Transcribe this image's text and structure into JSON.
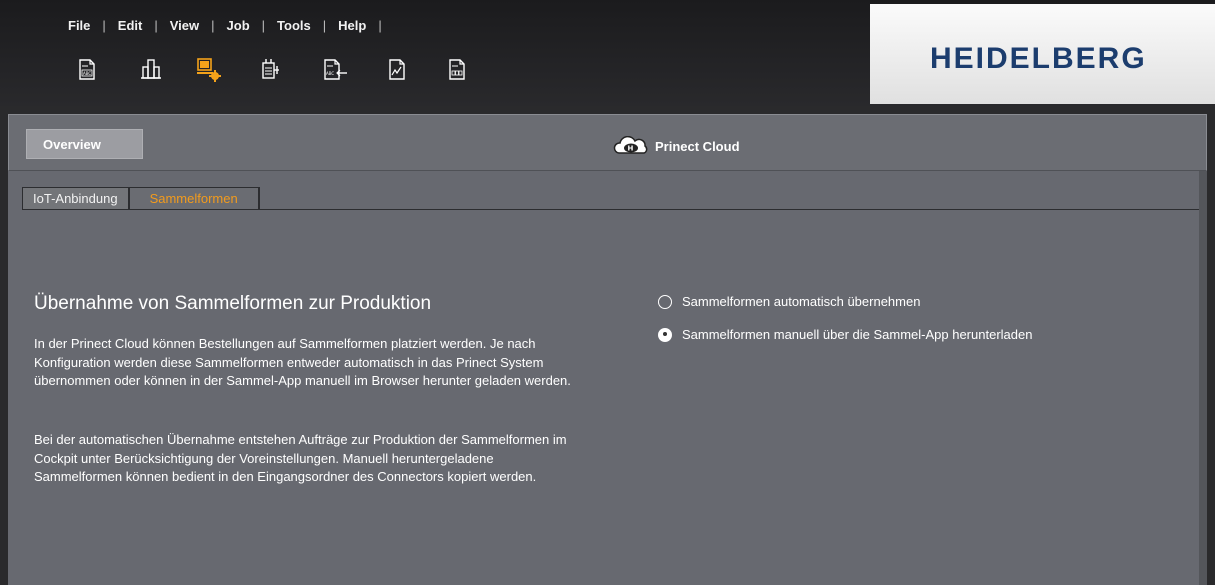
{
  "menu": {
    "items": [
      {
        "id": "file",
        "label": "File"
      },
      {
        "id": "edit",
        "label": "Edit"
      },
      {
        "id": "view",
        "label": "View"
      },
      {
        "id": "job",
        "label": "Job"
      },
      {
        "id": "tools",
        "label": "Tools"
      },
      {
        "id": "help",
        "label": "Help"
      }
    ],
    "separator": "|"
  },
  "toolbar": {
    "icons": [
      "document-abc-icon",
      "building-icon",
      "computer-gear-icon",
      "document-plug-icon",
      "document-abc-arrow-icon",
      "document-chart-icon",
      "document-grid-icon"
    ]
  },
  "brand": {
    "logo_text": "HEIDELBERG",
    "accent_color": "#f3b000",
    "logo_color": "#1c3d6e"
  },
  "topband": {
    "overview_label": "Overview",
    "cloud_title": "Prinect Cloud",
    "cloud_icon": "cloud-h-icon"
  },
  "tabs": [
    {
      "label": "IoT-Anbindung",
      "active": false
    },
    {
      "label": "Sammelformen",
      "active": true
    }
  ],
  "colors": {
    "active_tab": "#f29b1d"
  },
  "content": {
    "title": "Übernahme von Sammelformen zur Produktion",
    "paragraphs": [
      "In der Prinect Cloud können Bestellungen auf Sammelformen platziert werden. Je nach Konfiguration werden diese Sammelformen entweder automatisch in das Prinect System übernommen oder können in der Sammel-App manuell im Browser herunter geladen werden.",
      "Bei der automatischen Übernahme entstehen Aufträge zur Produktion der Sammelformen im Cockpit unter Berücksichtigung der Voreinstellungen. Manuell heruntergeladene Sammelformen können bedient in den Eingangsordner des Connectors kopiert werden."
    ]
  },
  "options": [
    {
      "label": "Sammelformen automatisch übernehmen",
      "selected": false
    },
    {
      "label": "Sammelformen manuell über die Sammel-App herunterladen",
      "selected": true
    }
  ]
}
